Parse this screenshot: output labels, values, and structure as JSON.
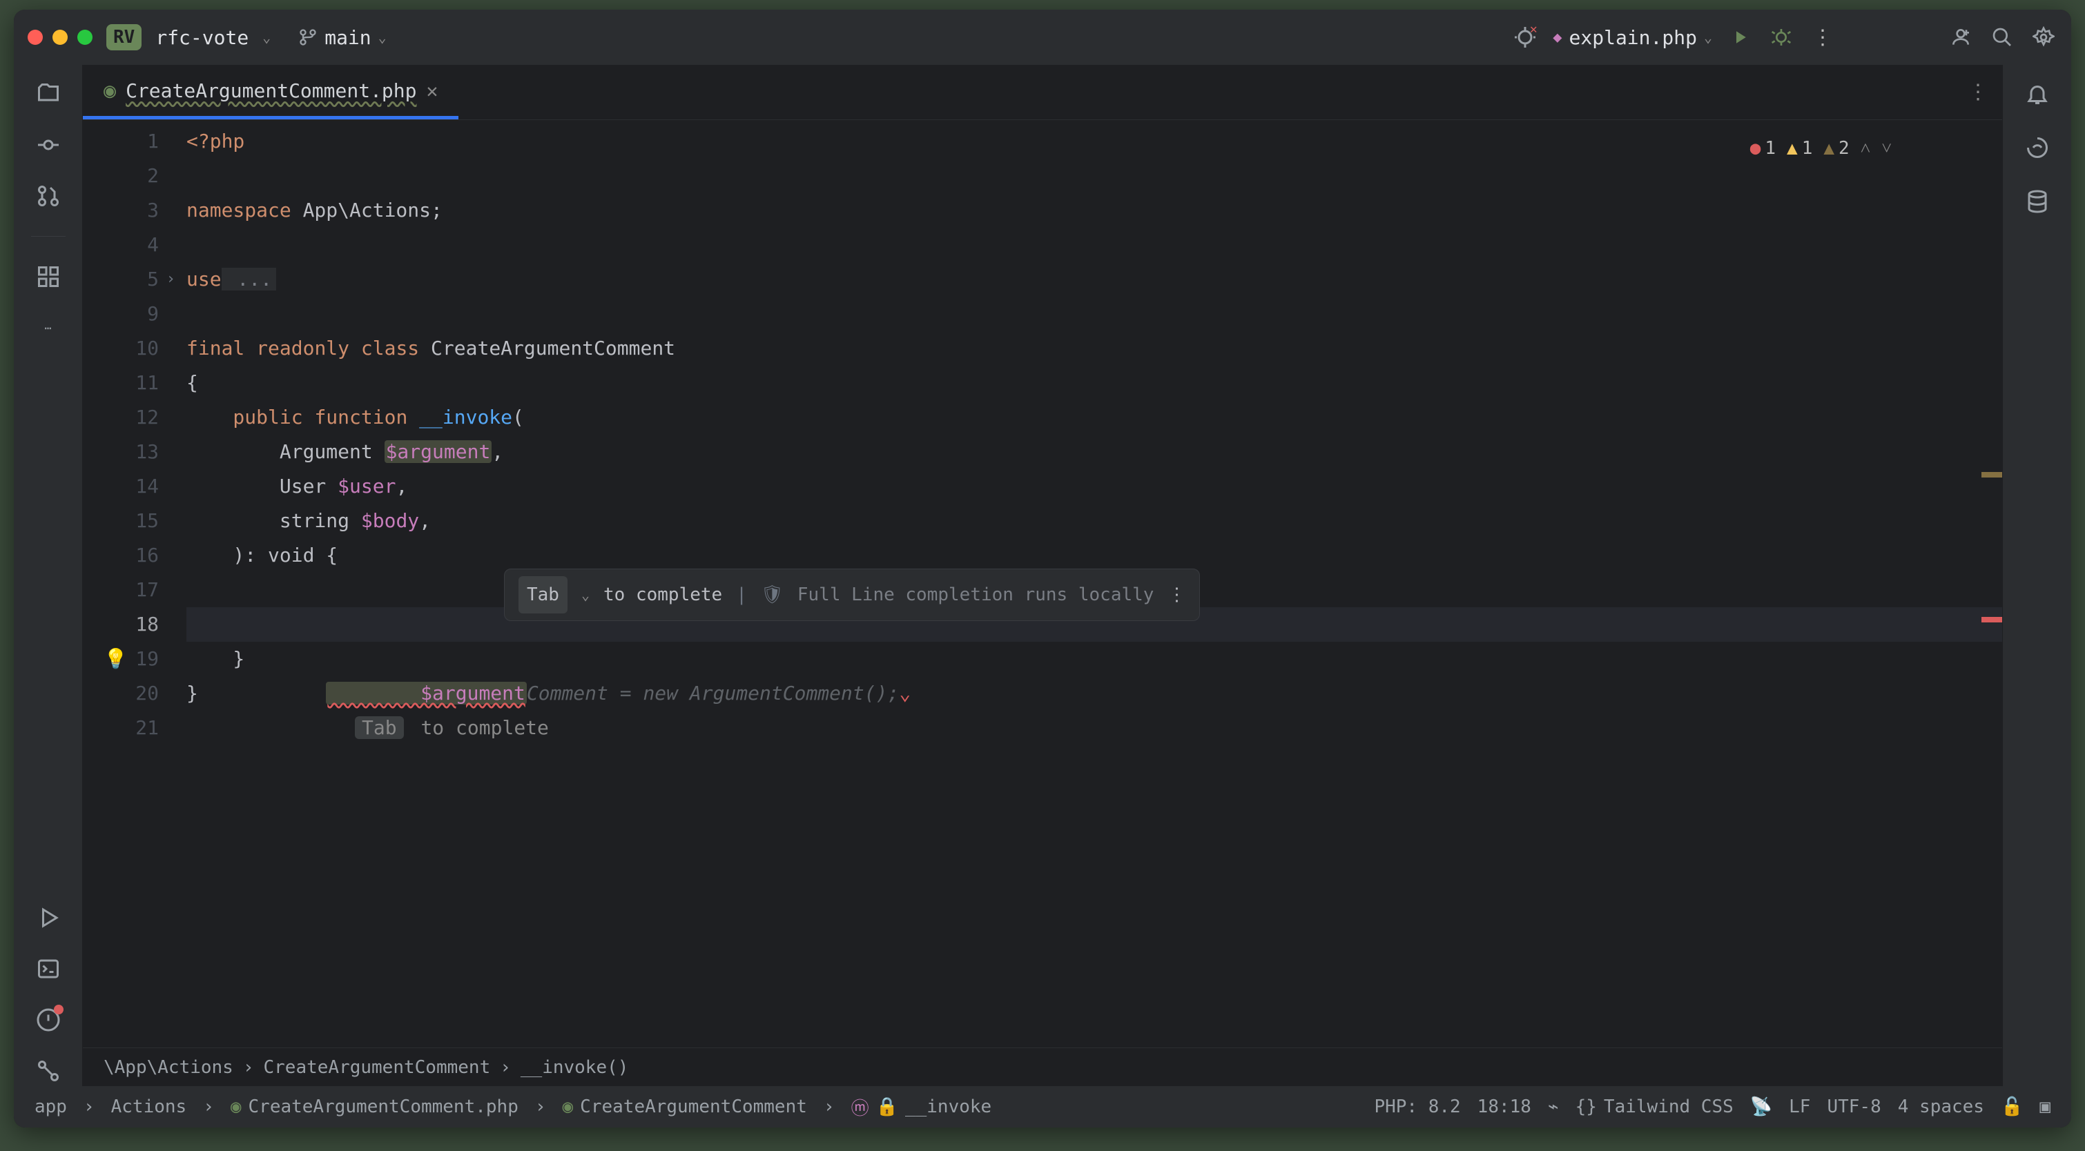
{
  "titlebar": {
    "project_badge": "RV",
    "project_name": "rfc-vote",
    "branch": "main",
    "run_config": "explain.php"
  },
  "tabs": {
    "file_name": "CreateArgumentComment.php"
  },
  "editor": {
    "errors": {
      "error": "1",
      "warning": "1",
      "weak": "2"
    },
    "lines": {
      "l1": "<?php",
      "l3_ns": "namespace",
      "l3_val": " App\\Actions;",
      "l5_use": "use",
      "l5_ell": " ...",
      "l10_final": "final",
      "l10_ro": " readonly ",
      "l10_class": "class",
      "l10_name": " CreateArgumentComment",
      "l11": "{",
      "l12_pub": "    public ",
      "l12_fn": "function ",
      "l12_name": "__invoke",
      "l12_paren": "(",
      "l13_type": "        Argument ",
      "l13_var": "$argument",
      "l13_c": ",",
      "l14_type": "        User ",
      "l14_var": "$user",
      "l14_c": ",",
      "l15_type": "        string ",
      "l15_var": "$body",
      "l15_c": ",",
      "l16": "    ): void {",
      "l18_var": "        $argument",
      "l18_ghost": "Comment = new ArgumentComment();",
      "l19": "    }",
      "l20": "}"
    },
    "gutter": [
      "1",
      "2",
      "3",
      "4",
      "5",
      "9",
      "10",
      "11",
      "12",
      "13",
      "14",
      "15",
      "16",
      "17",
      "18",
      "19",
      "20",
      "21"
    ],
    "hint": {
      "kbd": "Tab",
      "text": "to complete",
      "info": "Full Line completion runs locally"
    },
    "inline_hint": {
      "kbd": "Tab",
      "text": "to complete"
    }
  },
  "crumbs": {
    "c1": "\\App\\Actions",
    "c2": "CreateArgumentComment",
    "c3": "__invoke()"
  },
  "status": {
    "p1": "app",
    "p2": "Actions",
    "p3": "CreateArgumentComment.php",
    "p4": "CreateArgumentComment",
    "p5": "__invoke",
    "php": "PHP: 8.2",
    "pos": "18:18",
    "tw": "Tailwind CSS",
    "eol": "LF",
    "enc": "UTF-8",
    "indent": "4 spaces"
  }
}
